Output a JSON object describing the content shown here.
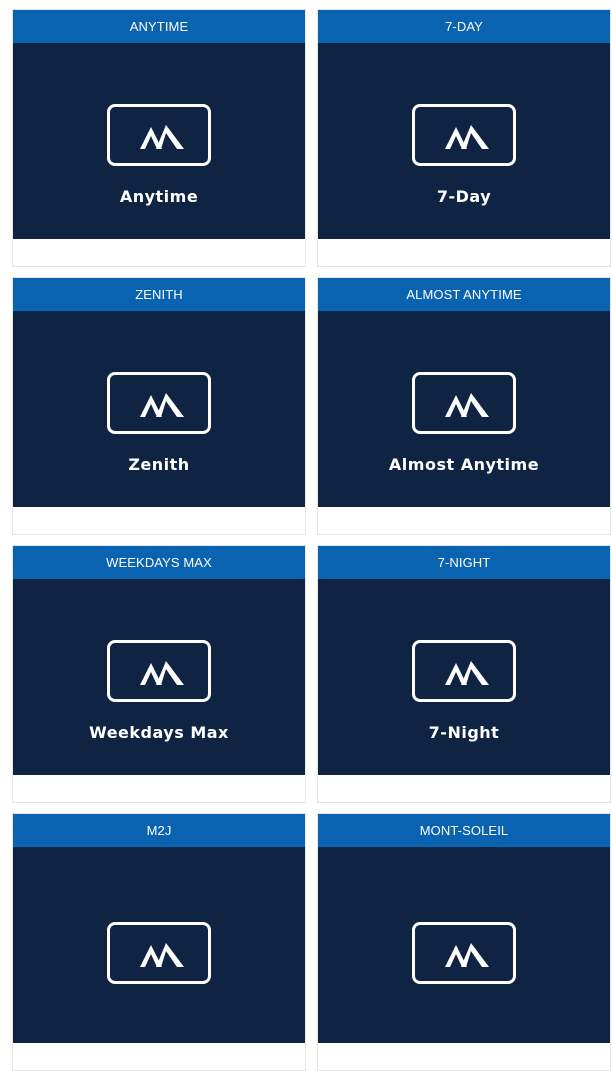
{
  "passes": [
    {
      "header": "ANYTIME",
      "name": "Anytime",
      "icon": "mountain-icon"
    },
    {
      "header": "7-DAY",
      "name": "7-Day",
      "icon": "mountain-icon"
    },
    {
      "header": "ZENITH",
      "name": "Zenith",
      "icon": "mountain-icon"
    },
    {
      "header": "ALMOST ANYTIME",
      "name": "Almost Anytime",
      "icon": "mountain-icon"
    },
    {
      "header": "WEEKDAYS MAX",
      "name": "Weekdays Max",
      "icon": "mountain-icon"
    },
    {
      "header": "7-NIGHT",
      "name": "7-Night",
      "icon": "mountain-icon"
    },
    {
      "header": "M2J",
      "name": "",
      "icon": "mountain-icon"
    },
    {
      "header": "MONT-SOLEIL",
      "name": "",
      "icon": "mountain-icon"
    }
  ],
  "colors": {
    "header_bg": "#0a63b0",
    "media_bg": "#0f2442",
    "text": "#ffffff"
  }
}
